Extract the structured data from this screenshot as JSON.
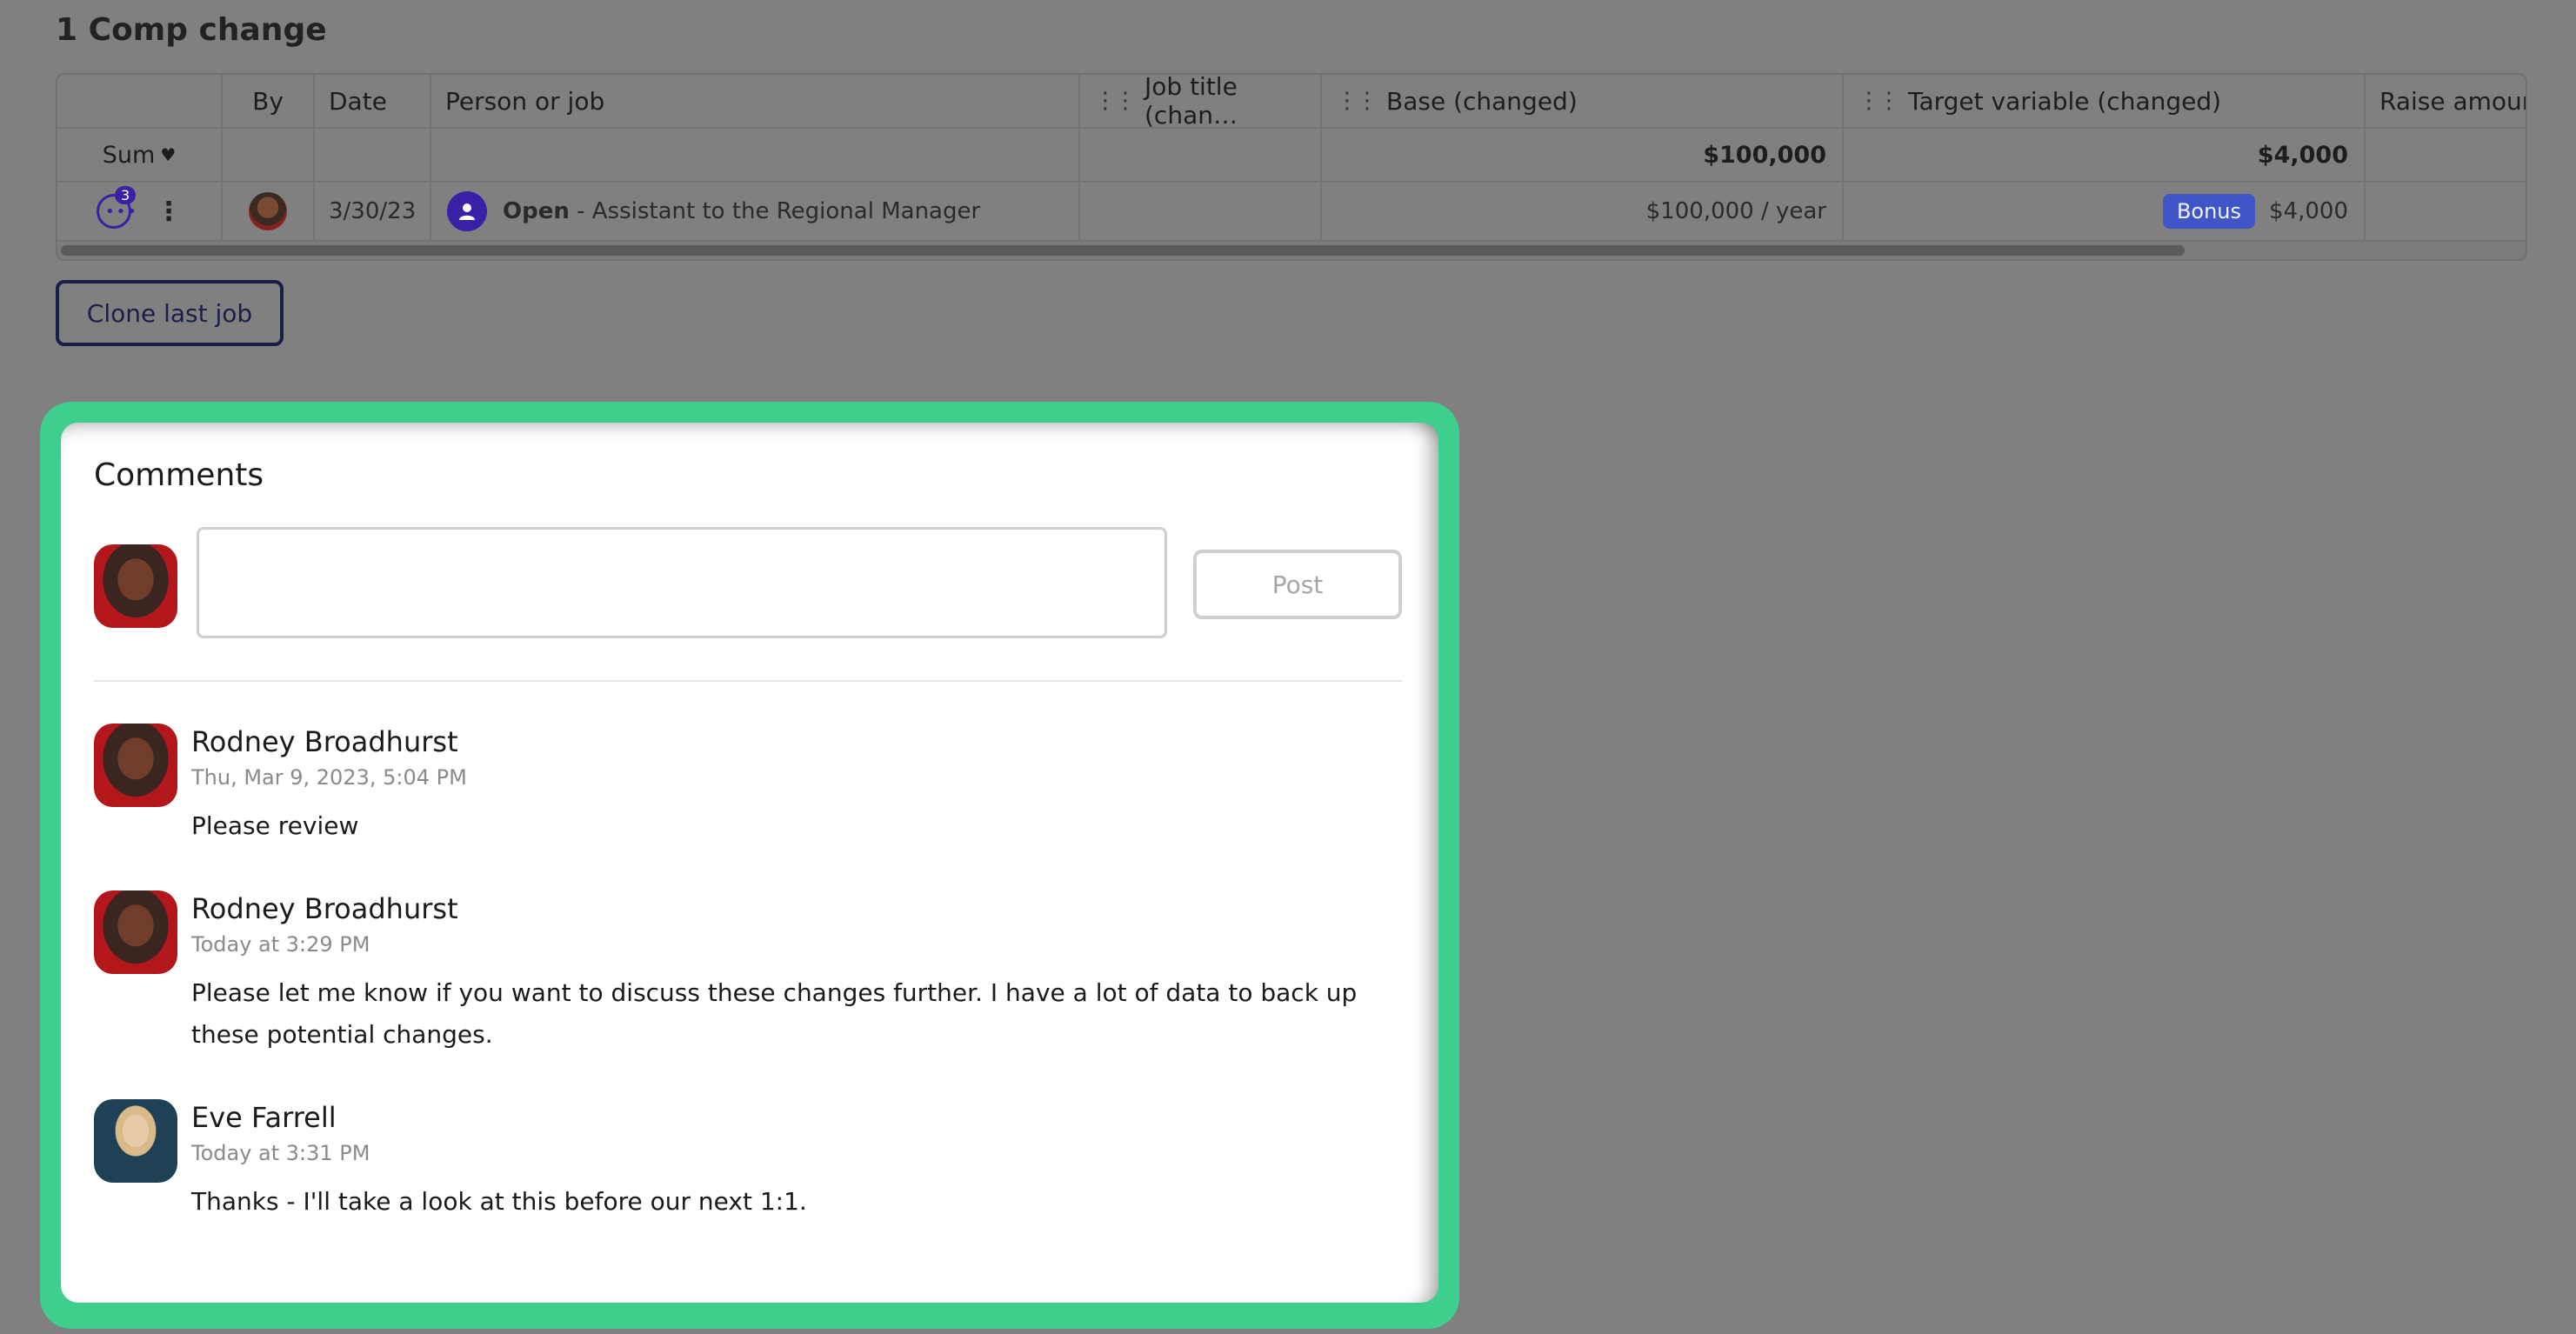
{
  "section": {
    "title": "1 Comp change"
  },
  "table": {
    "headers": {
      "by": "By",
      "date": "Date",
      "person": "Person or job",
      "job_title": "Job title (chan…",
      "base": "Base (changed)",
      "target": "Target variable (changed)",
      "raise": "Raise amount"
    },
    "sum_label": "Sum",
    "sum_base": "$100,000",
    "sum_target": "$4,000",
    "row": {
      "comment_count": "3",
      "date": "3/30/23",
      "status": "Open",
      "job": " - Assistant to the Regional Manager",
      "base": "$100,000 / year",
      "bonus_badge": "Bonus",
      "target": "$4,000"
    }
  },
  "clone_button": "Clone last job",
  "comments": {
    "title": "Comments",
    "post_button": "Post",
    "input_value": "",
    "items": [
      {
        "author": "Rodney Broadhurst",
        "time": "Thu, Mar 9, 2023, 5:04 PM",
        "text": "Please review"
      },
      {
        "author": "Rodney Broadhurst",
        "time": "Today at 3:29 PM",
        "text": "Please let me know if you want to discuss these changes further. I have a lot of data to back up these potential changes."
      },
      {
        "author": "Eve Farrell",
        "time": "Today at 3:31 PM",
        "text": "Thanks - I'll take a look at this before our next 1:1."
      }
    ]
  },
  "colors": {
    "accent_frame": "#3ecf8e",
    "brand_purple": "#3a20a6",
    "bonus_badge": "#3f55c8"
  },
  "icons": [
    "comment-icon",
    "more-vertical-icon",
    "person-icon",
    "drag-handle-icon",
    "caret-down-icon"
  ]
}
